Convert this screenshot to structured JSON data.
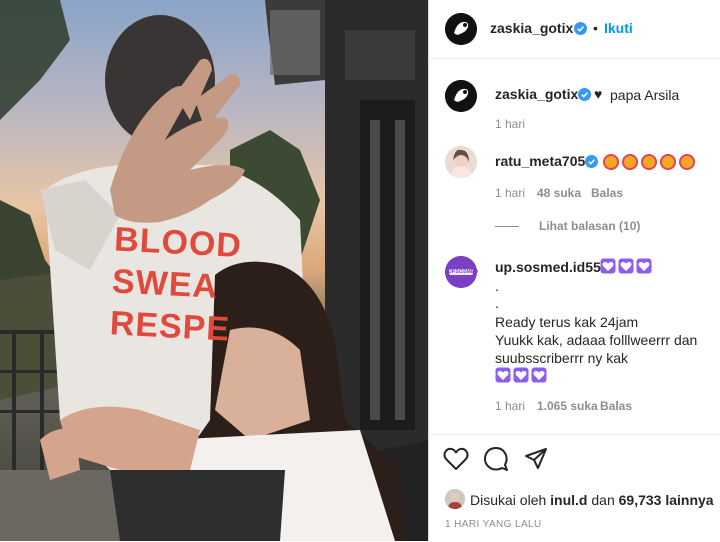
{
  "post": {
    "author": "zaskia_gotix",
    "follow_label": "Ikuti",
    "separator": "•",
    "shirt_text": "BLOOD\nSWEA\nRESPE"
  },
  "caption": {
    "username": "zaskia_gotix",
    "heart": "♥",
    "text": "papa Arsila",
    "time": "1 hari"
  },
  "comments": [
    {
      "username": "ratu_meta705",
      "emoji": "🤩🤩🤩🤩🤩",
      "time": "1 hari",
      "likes": "48 suka",
      "reply": "Balas",
      "view_replies": "Lihat balasan (10)"
    },
    {
      "username": "up.sosmed.id55",
      "hearts": "💜💜💜",
      "lines": [
        ".",
        ".",
        "Ready terus kak 24jam",
        "Yuukk kak, adaaa folllweerrr dan",
        "suubsscriberrr ny kak"
      ],
      "hearts_end": "💜💜💜",
      "time": "1 hari",
      "likes": "1.065 suka",
      "reply": "Balas",
      "avatar_text": "UPSOSMED"
    }
  ],
  "actions": {
    "liked_prefix": "Disukai oleh",
    "liked_user": "inul.d",
    "liked_and": "dan",
    "liked_count": "69,733 lainnya",
    "date": "1 HARI YANG LALU"
  },
  "colors": {
    "link": "#0095f6",
    "verified": "#3897f0",
    "emoji": "#f5a623",
    "purple": "#8e5cf0",
    "text": "#262626",
    "muted": "#8e8e8e"
  }
}
